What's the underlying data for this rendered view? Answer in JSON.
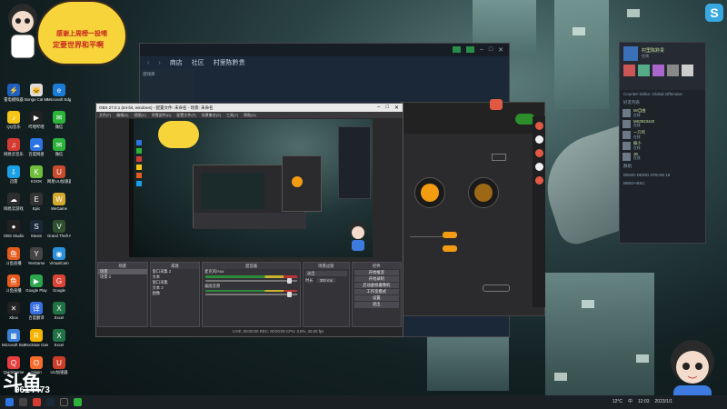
{
  "banner": {
    "line1": "感谢上周榜一投喂",
    "line2": "定要世界和平啊"
  },
  "desktop_icons": [
    {
      "label": "雷电模拟器",
      "color": "#1f5fbf",
      "glyph": "⚡"
    },
    {
      "label": "Bongo Cat Mver",
      "color": "#ddd",
      "glyph": "🐱"
    },
    {
      "label": "Microsoft Edge",
      "color": "#1d7bd8",
      "glyph": "e"
    },
    {
      "label": "QQ音乐",
      "color": "#f5c518",
      "glyph": "♪"
    },
    {
      "label": "哔哩哔哩",
      "color": "#222",
      "glyph": "▶"
    },
    {
      "label": "微信",
      "color": "#2db33b",
      "glyph": "✉"
    },
    {
      "label": "网易云音乐",
      "color": "#d43c33",
      "glyph": "♫"
    },
    {
      "label": "百度网盘",
      "color": "#2b74e2",
      "glyph": "☁"
    },
    {
      "label": "微信",
      "color": "#2db33b",
      "glyph": "✉"
    },
    {
      "label": "迅雷",
      "color": "#1aa0e6",
      "glyph": "⇩"
    },
    {
      "label": "KOOK",
      "color": "#6fbf3c",
      "glyph": "K"
    },
    {
      "label": "网易UU加速器",
      "color": "#c84b2e",
      "glyph": "U"
    },
    {
      "label": "网易云游戏",
      "color": "#2d2d2d",
      "glyph": "☁"
    },
    {
      "label": "Epic",
      "color": "#333",
      "glyph": "E"
    },
    {
      "label": "WeGame",
      "color": "#d4a82c",
      "glyph": "W"
    },
    {
      "label": "OBS Studio",
      "color": "#222",
      "glyph": "●"
    },
    {
      "label": "Steam",
      "color": "#1b2838",
      "glyph": "S"
    },
    {
      "label": "Grand Theft Auto V",
      "color": "#2f4f2f",
      "glyph": "V"
    },
    {
      "label": "斗鱼直播",
      "color": "#e65b1c",
      "glyph": "鱼"
    },
    {
      "label": "YesGame",
      "color": "#444",
      "glyph": "Y"
    },
    {
      "label": "VirtualCam",
      "color": "#2b8fd9",
      "glyph": "◉"
    },
    {
      "label": "斗鱼直播",
      "color": "#e65b1c",
      "glyph": "鱼"
    },
    {
      "label": "Google Play",
      "color": "#2da44e",
      "glyph": "▶"
    },
    {
      "label": "Google",
      "color": "#db4437",
      "glyph": "G"
    },
    {
      "label": "Xbox",
      "color": "#222",
      "glyph": "✕"
    },
    {
      "label": "百度翻译",
      "color": "#3a6fe0",
      "glyph": "译"
    },
    {
      "label": "Excel",
      "color": "#217346",
      "glyph": "X"
    },
    {
      "label": "Microsoft Store",
      "color": "#3a80d9",
      "glyph": "▦"
    },
    {
      "label": "Rockstar Games",
      "color": "#f5b400",
      "glyph": "R"
    },
    {
      "label": "Excel",
      "color": "#217346",
      "glyph": "X"
    },
    {
      "label": "QuickGame",
      "color": "#e63e3e",
      "glyph": "Q"
    },
    {
      "label": "Origin",
      "color": "#f56c2d",
      "glyph": "O"
    },
    {
      "label": "UU加速器",
      "color": "#cc3d2a",
      "glyph": "U"
    }
  ],
  "brand": {
    "logo": "斗鱼",
    "room": "9614473"
  },
  "steam": {
    "nav": [
      "商店",
      "社区",
      "村里陈黔贵"
    ],
    "tabs_label": "游戏库"
  },
  "obs": {
    "title": "OBS 27.0.1 (64-bit, windows) - 配置文件: 未命名 - 场景: 未命名",
    "menu": [
      "文件(F)",
      "编辑(E)",
      "视图(V)",
      "停靠部件(D)",
      "配置文件(P)",
      "场景集合(S)",
      "工具(T)",
      "帮助(H)"
    ],
    "docks": {
      "scenes": {
        "title": "场景",
        "items": [
          "场景",
          "场景 2"
        ]
      },
      "sources": {
        "title": "来源",
        "items": [
          "窗口采集 2",
          "文本",
          "窗口采集",
          "文本 2",
          "图像"
        ]
      },
      "mixer": {
        "title": "混音器",
        "tracks": [
          "麦克风/Aux",
          "桌面音频"
        ]
      },
      "transitions": {
        "title": "场景过渡",
        "mode": "淡出",
        "duration_label": "时长",
        "duration": "300 ms"
      },
      "controls": {
        "title": "控件",
        "buttons": [
          "开始推流",
          "开始录制",
          "启动虚拟摄像机",
          "工作室模式",
          "设置",
          "退出"
        ]
      }
    },
    "status": "LIVE: 00:00:00   REC: 00:00:00   CPU: 3.5%, 30.00 fps"
  },
  "friends": {
    "user": "村里陈黔贵",
    "status": "在线",
    "game": "Counter-Strike: Global Offensive",
    "sections": [
      "好友列表",
      "游戏中",
      "在线好友"
    ],
    "list": [
      {
        "name": "Mr自由",
        "status": "在线"
      },
      {
        "name": "MK0923420",
        "status": "在线"
      },
      {
        "name": "一只鸡",
        "status": "在线"
      },
      {
        "name": "楠小",
        "status": "在线"
      },
      {
        "name": "JB",
        "status": "在线"
      }
    ],
    "groups_title": "群组",
    "groups": [
      "DEMO DEMO STEAM 18",
      "BB5D+BSC"
    ]
  },
  "taskbar": {
    "time": "12:03",
    "date": "2023/1/1",
    "temp": "12°C",
    "lang": "中"
  }
}
